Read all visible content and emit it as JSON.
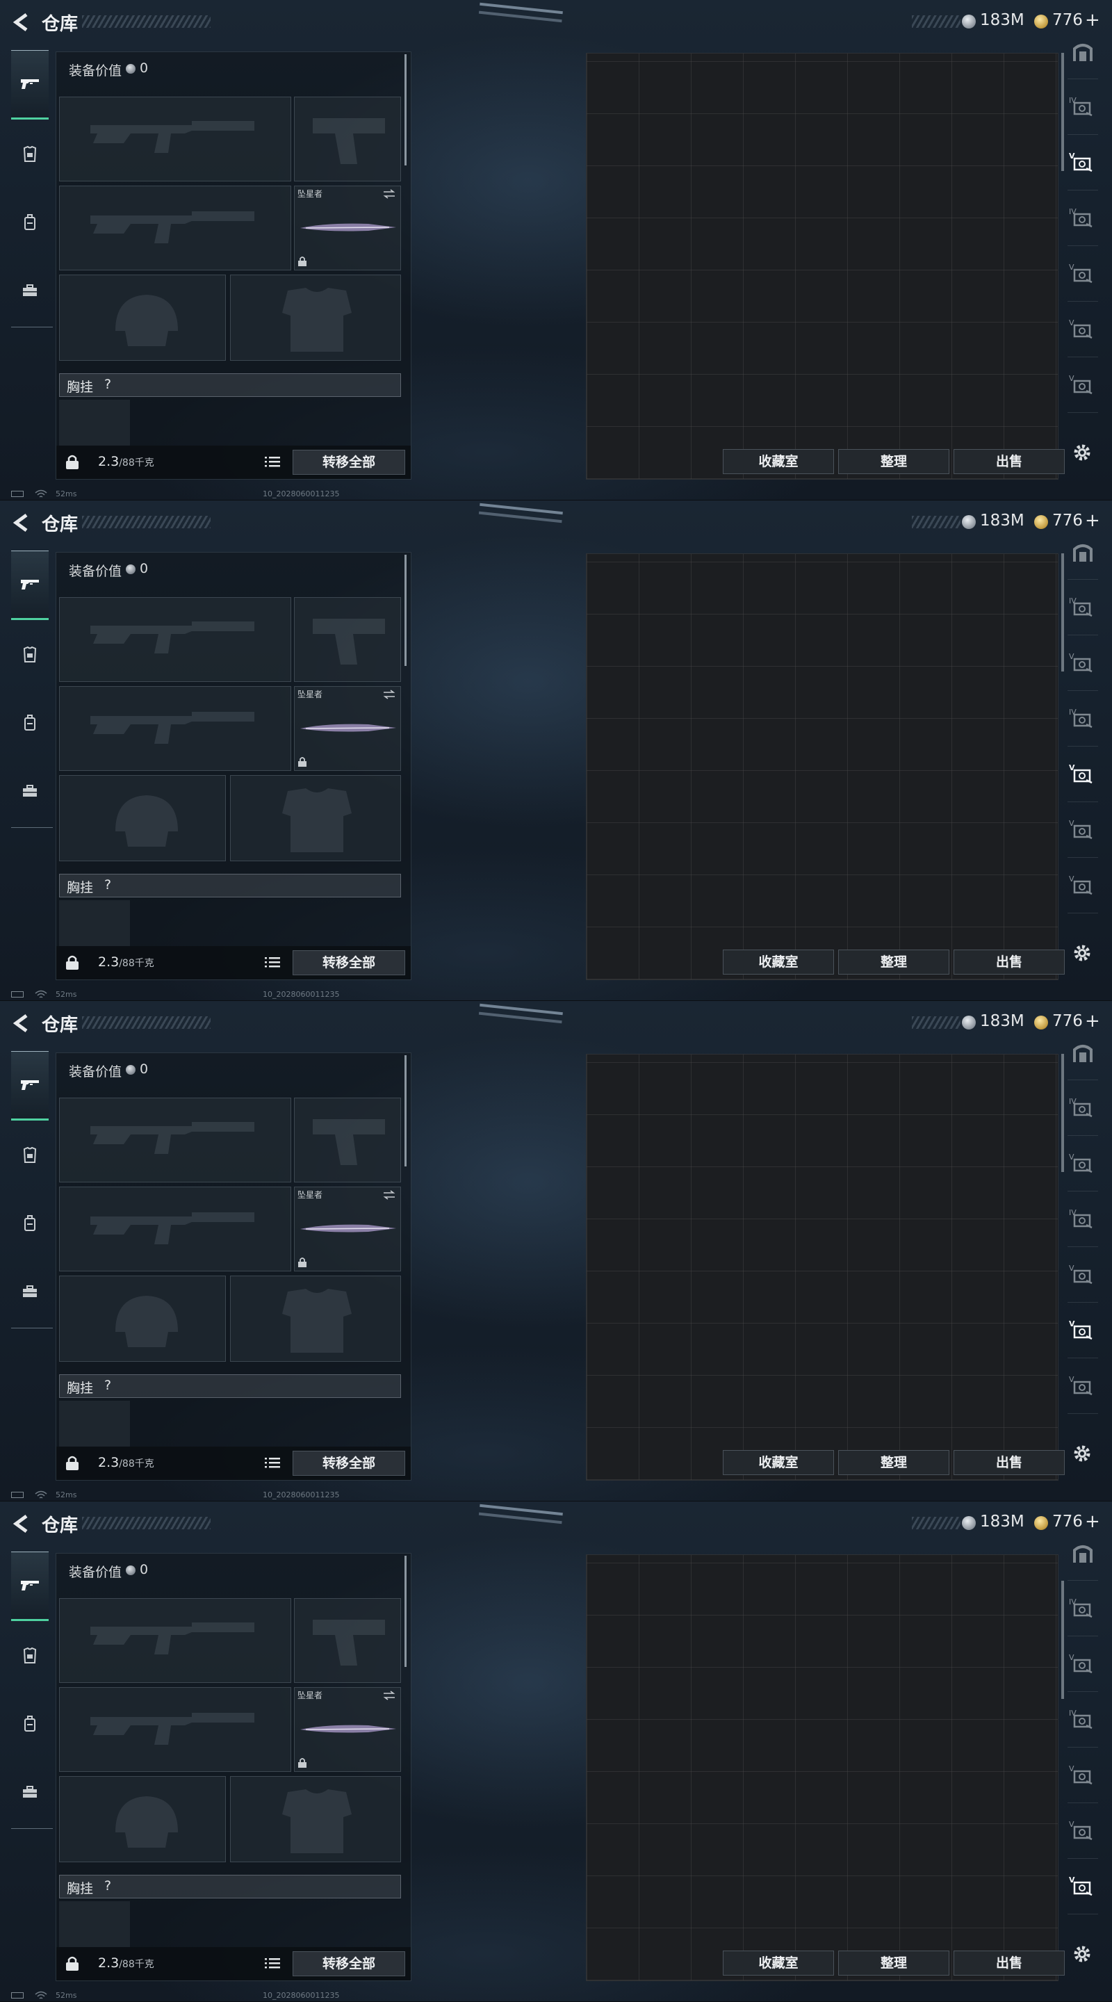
{
  "frames": [
    {
      "active_tab_index": 2,
      "scroll_offset": 0
    },
    {
      "active_tab_index": 4,
      "scroll_offset": 0
    },
    {
      "active_tab_index": 5,
      "scroll_offset": 0
    },
    {
      "active_tab_index": 6,
      "scroll_offset": 1
    }
  ],
  "header": {
    "title": "仓库",
    "silver_amount": "183M",
    "gold_amount": "776",
    "gold_plus": "+"
  },
  "equipment": {
    "value_label": "装备价值",
    "value_amount": "0",
    "melee_name": "坠星者",
    "chest_label": "胸挂",
    "chest_help": "?",
    "weight_current": "2.3",
    "weight_max": "/88千克",
    "transfer_all_label": "转移全部"
  },
  "side_tabs": [
    "gun-icon",
    "armor-icon",
    "backpack-icon",
    "case-icon"
  ],
  "right_tabs": [
    {
      "icon": "vault-icon",
      "level": ""
    },
    {
      "icon": "storage-icon",
      "level": "IV"
    },
    {
      "icon": "storage-icon",
      "level": "V"
    },
    {
      "icon": "storage-icon",
      "level": "IV"
    },
    {
      "icon": "storage-icon",
      "level": "V"
    },
    {
      "icon": "storage-icon",
      "level": "V"
    },
    {
      "icon": "storage-icon",
      "level": "V"
    }
  ],
  "actions": {
    "collection_label": "收藏室",
    "sort_label": "整理",
    "sell_label": "出售"
  },
  "status": {
    "ping": "52ms",
    "build": "10_2028060011235"
  },
  "colors": {
    "accent_green": "#4fd1a0",
    "gold": "#c29a3e",
    "silver": "#8b939c"
  }
}
